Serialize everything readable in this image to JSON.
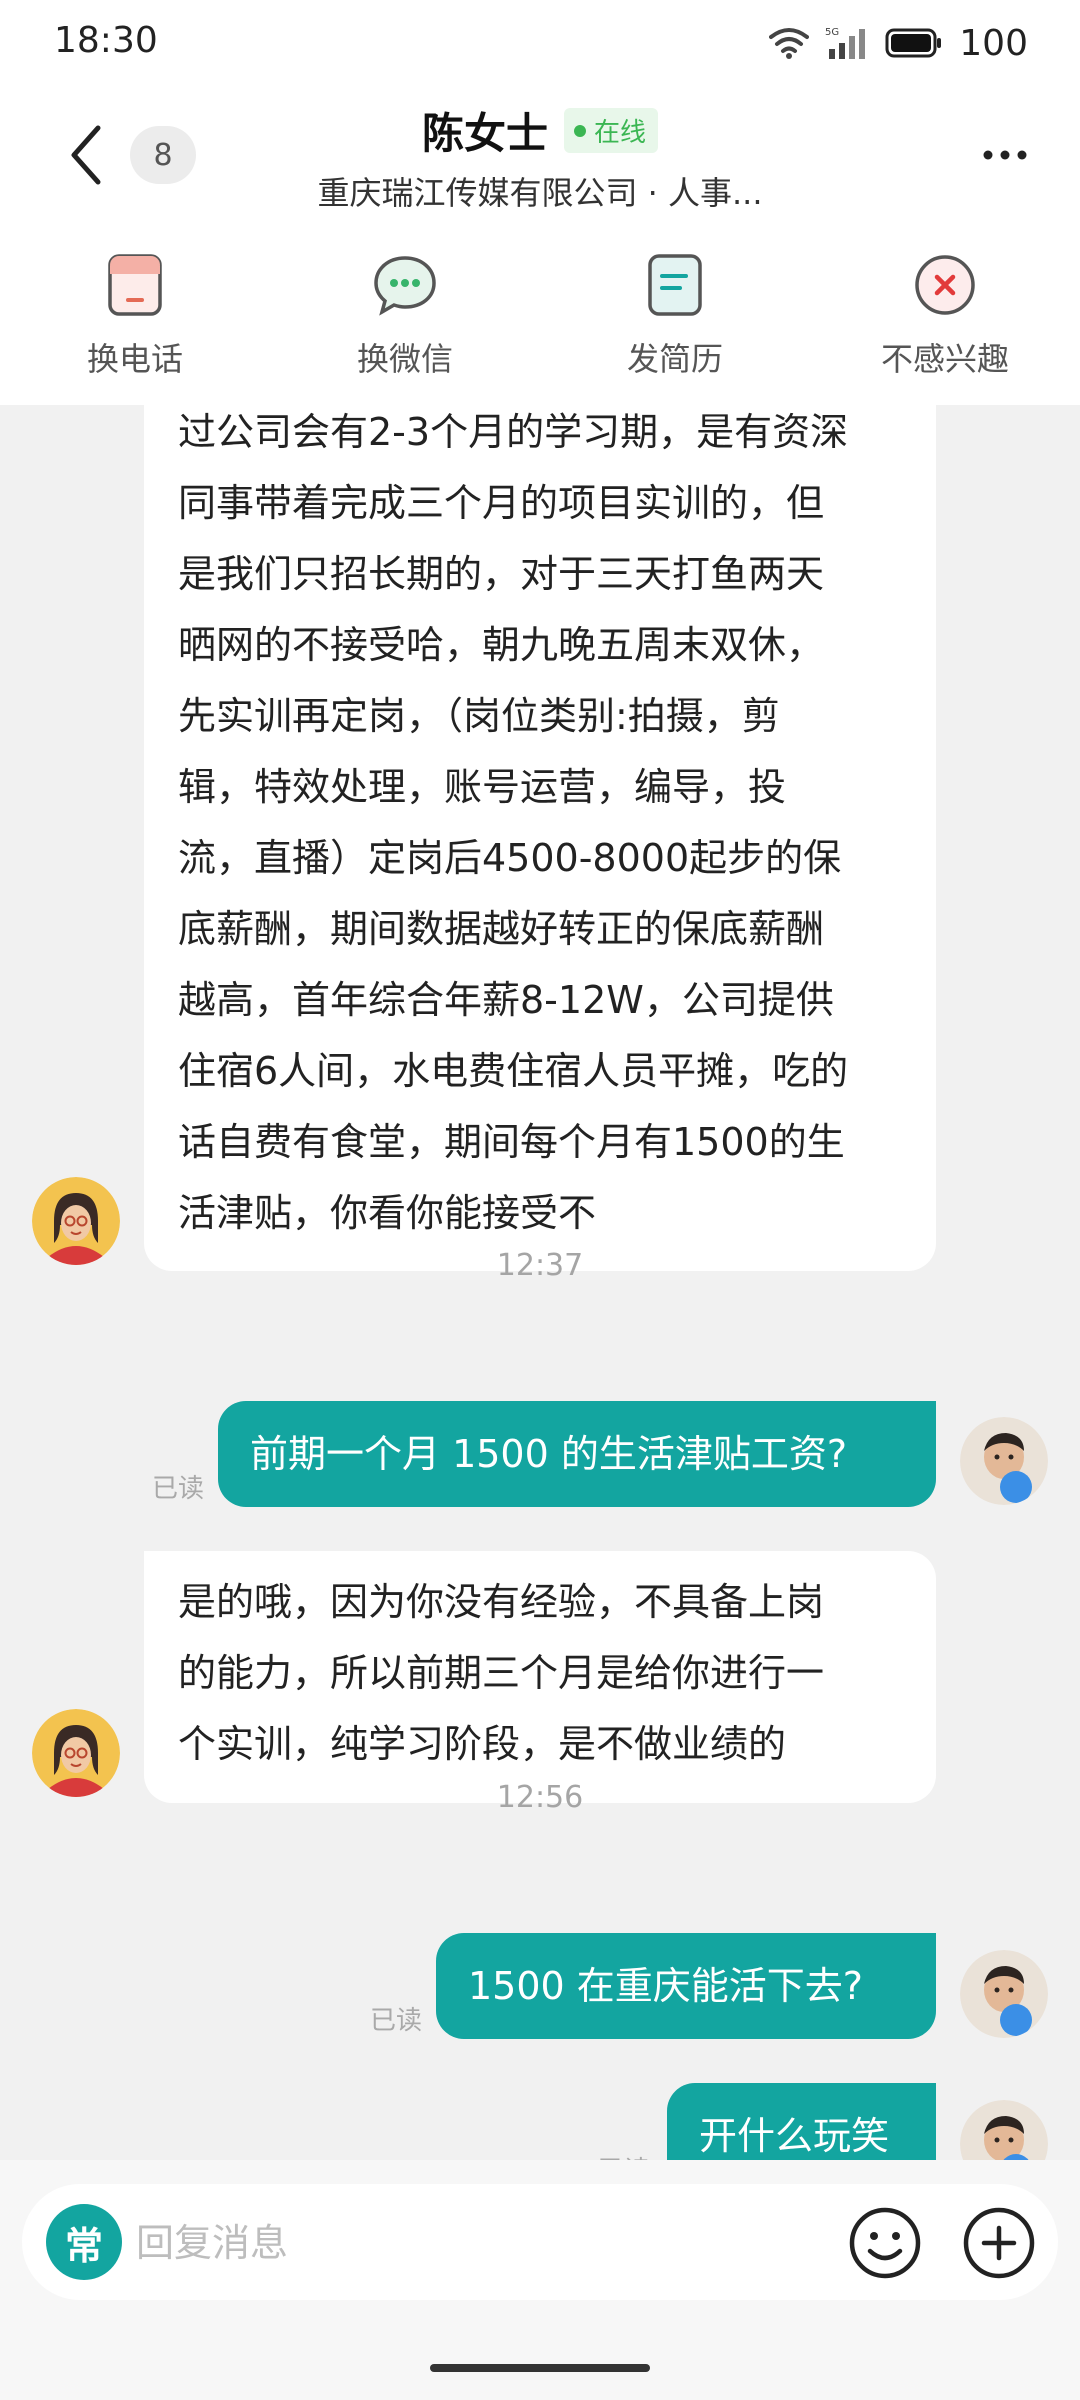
{
  "status_bar": {
    "time": "18:30",
    "network": "5G",
    "battery": "100"
  },
  "header": {
    "unread_count": "8",
    "title": "陈女士",
    "online_label": "在线",
    "subtitle": "重庆瑞江传媒有限公司 · 人事..."
  },
  "actions": [
    {
      "label": "换电话",
      "icon": "phone-swap-icon"
    },
    {
      "label": "换微信",
      "icon": "wechat-icon"
    },
    {
      "label": "发简历",
      "icon": "resume-icon"
    },
    {
      "label": "不感兴趣",
      "icon": "not-interested-icon"
    }
  ],
  "messages": {
    "m1_lines": [
      "过公司会有2-3个月的学习期，是有资深",
      "同事带着完成三个月的项目实训的，但",
      "是我们只招长期的，对于三天打鱼两天",
      "晒网的不接受哈，朝九晚五周末双休，",
      "先实训再定岗，（岗位类别:拍摄，剪",
      "辑，特效处理，账号运营，编导，投",
      "流，直播）定岗后4500-8000起步的保",
      "底薪酬，期间数据越好转正的保底薪酬",
      "越高，首年综合年薪8-12W，公司提供",
      "住宿6人间，水电费住宿人员平摊，吃的",
      "话自费有食堂，期间每个月有1500的生",
      "活津贴，你看你能接受不"
    ],
    "time1": "12:37",
    "m2": "前期一个月 1500 的生活津贴工资?",
    "m2_status": "已读",
    "m3_lines": [
      "是的哦，因为你没有经验，不具备上岗",
      "的能力，所以前期三个月是给你进行一",
      "个实训，纯学习阶段，是不做业绩的"
    ],
    "time2": "12:56",
    "m4": "1500 在重庆能活下去?",
    "m4_status": "已读",
    "m5": "开什么玩笑",
    "m5_status": "已读"
  },
  "input": {
    "quick_label": "常",
    "placeholder": "回复消息"
  },
  "colors": {
    "accent": "#13a5a0",
    "online": "#3bb653"
  }
}
